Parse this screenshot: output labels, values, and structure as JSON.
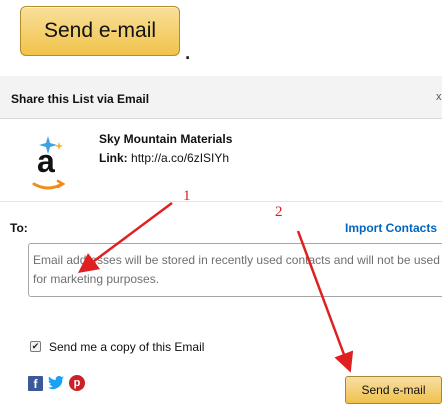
{
  "top_button": {
    "label": "Send e-mail"
  },
  "period": ".",
  "dialog": {
    "title": "Share this List via Email",
    "close": "x",
    "list_name": "Sky Mountain Materials",
    "link_label": "Link:",
    "link_url": "http://a.co/6zISIYh",
    "to_label": "To:",
    "import_contacts": "Import Contacts",
    "email_placeholder": "Email addresses will be stored in recently used contacts and will not be used for marketing purposes.",
    "copy_checked": true,
    "copy_label": "Send me a copy of this Email",
    "send_label": "Send e-mail",
    "logo_letter": "a"
  },
  "annotations": {
    "one": "1",
    "two": "2"
  },
  "colors": {
    "link": "#0066c0",
    "button": "#f0c14b",
    "arrow": "#e02020",
    "facebook": "#3b5998",
    "twitter": "#1da1f2",
    "pinterest": "#cb2027"
  },
  "icons": [
    "amazon-logo-icon",
    "facebook-icon",
    "twitter-icon",
    "pinterest-icon",
    "close-icon",
    "checkbox-icon"
  ]
}
